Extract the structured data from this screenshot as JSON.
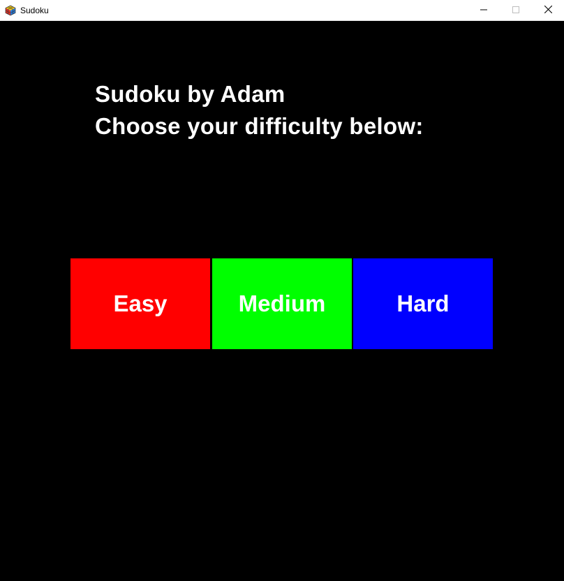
{
  "window": {
    "title": "Sudoku",
    "icon": "rubiks-cube-icon",
    "controls": {
      "minimize_icon": "minimize-icon",
      "maximize_icon": "maximize-icon",
      "close_icon": "close-icon"
    }
  },
  "screen": {
    "background_color": "#000000",
    "heading_line_1": "Sudoku by Adam",
    "heading_line_2": "Choose your difficulty below:"
  },
  "difficulties": [
    {
      "label": "Easy",
      "color": "#ff0000"
    },
    {
      "label": "Medium",
      "color": "#00ff00"
    },
    {
      "label": "Hard",
      "color": "#0000ff"
    }
  ]
}
